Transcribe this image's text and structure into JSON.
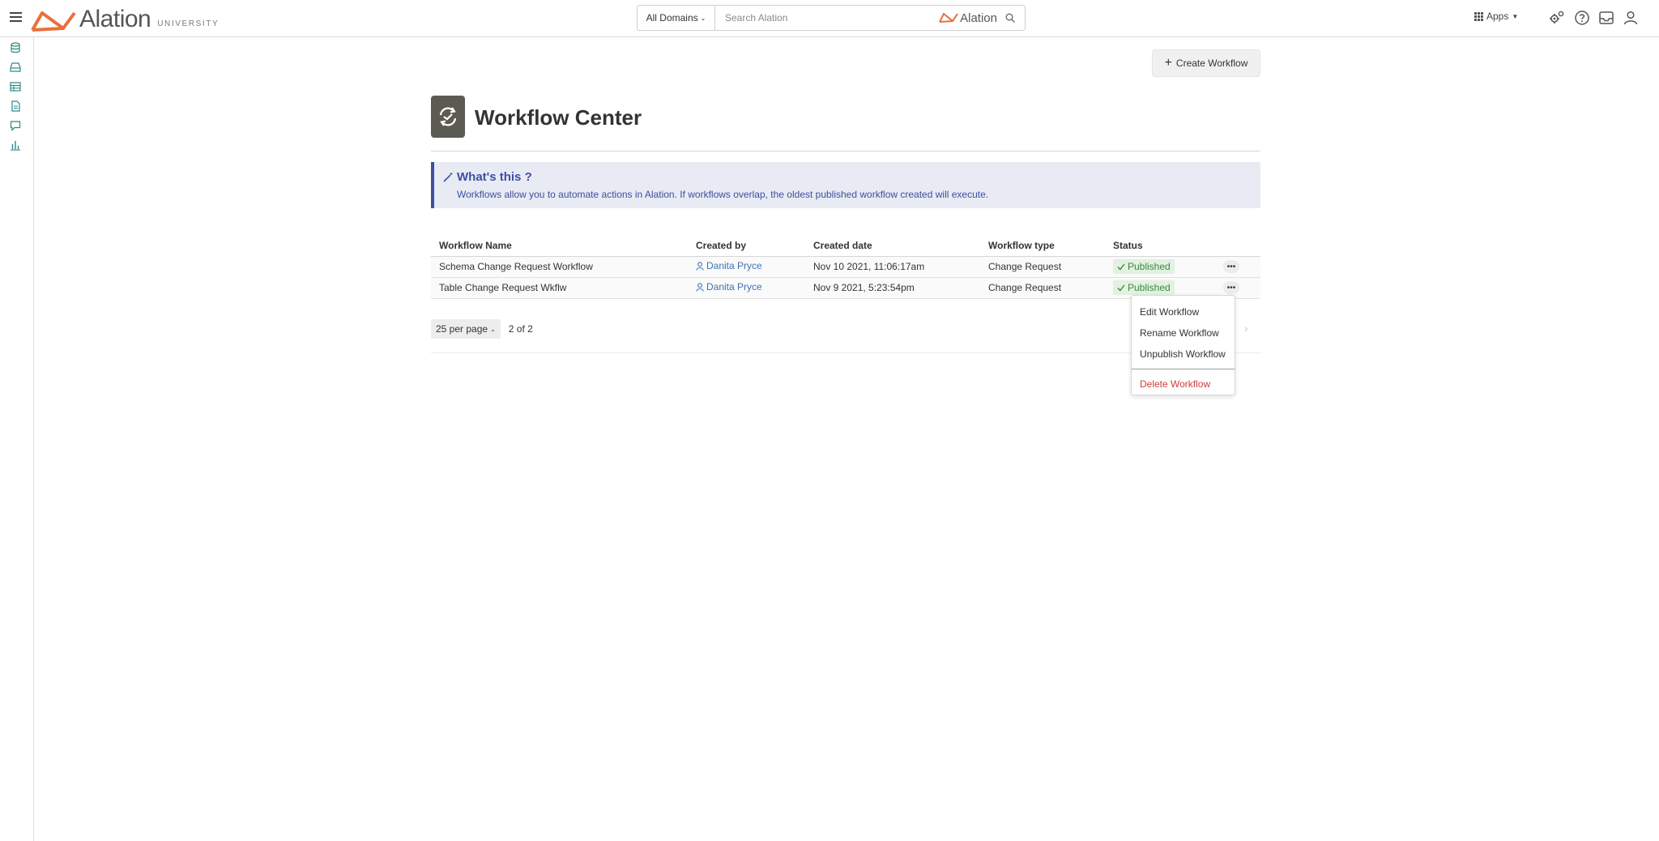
{
  "header": {
    "brand": "Alation",
    "brand_sub": "UNIVERSITY",
    "domain_selector": "All Domains",
    "search_placeholder": "Search Alation",
    "search_brand": "Alation",
    "apps_label": "Apps"
  },
  "main": {
    "create_button": "Create Workflow",
    "title": "Workflow Center",
    "info": {
      "title": "What's this ?",
      "text": "Workflows allow you to automate actions in Alation. If workflows overlap, the oldest published workflow created will execute."
    },
    "table": {
      "columns": [
        "Workflow Name",
        "Created by",
        "Created date",
        "Workflow type",
        "Status"
      ],
      "rows": [
        {
          "name": "Schema Change Request Workflow",
          "created_by": "Danita Pryce",
          "created_date": "Nov 10 2021, 11:06:17am",
          "type": "Change Request",
          "status": "Published"
        },
        {
          "name": "Table Change Request Wkflw",
          "created_by": "Danita Pryce",
          "created_date": "Nov 9 2021, 5:23:54pm",
          "type": "Change Request",
          "status": "Published"
        }
      ]
    },
    "pagination": {
      "per_page": "25 per page",
      "count": "2 of 2"
    },
    "row_menu": {
      "items": [
        "Edit Workflow",
        "Rename Workflow",
        "Unpublish Workflow"
      ],
      "danger_item": "Delete Workflow"
    }
  },
  "colors": {
    "brand_orange": "#e8703a",
    "info_accent": "#3d4fa0",
    "link_blue": "#3d73b5",
    "published_green": "#3c8a3a",
    "danger_red": "#c9403a",
    "rail_teal": "#2a8a8a"
  }
}
